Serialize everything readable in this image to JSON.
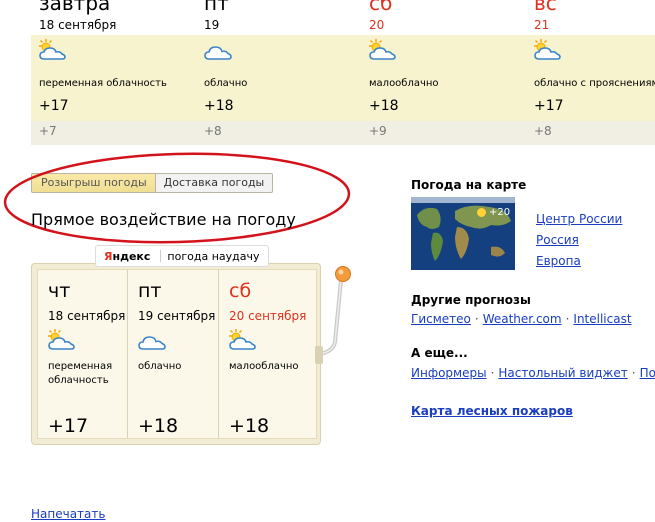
{
  "forecast": {
    "days": [
      {
        "day": "завтра",
        "date": "18 сентября",
        "desc": "переменная облачность",
        "day_temp": "+17",
        "night_temp": "+7",
        "icon": "sun-cloud-icon",
        "weekend": false
      },
      {
        "day": "пт",
        "date": "19",
        "desc": "облачно",
        "day_temp": "+18",
        "night_temp": "+8",
        "icon": "cloud-icon",
        "weekend": false
      },
      {
        "day": "сб",
        "date": "20",
        "desc": "малооблачно",
        "day_temp": "+18",
        "night_temp": "+9",
        "icon": "sun-cloud-icon",
        "weekend": true
      },
      {
        "day": "вс",
        "date": "21",
        "desc": "облачно с прояснениями",
        "day_temp": "+17",
        "night_temp": "+8",
        "icon": "sun-cloud-icon",
        "weekend": true
      }
    ]
  },
  "tabs": [
    "Розыгрыш погоды",
    "Доставка погоды"
  ],
  "promo": {
    "title": "Прямое воздействие на погоду"
  },
  "widget": {
    "badge_logo_a": "Я",
    "badge_logo_b": "ндекс",
    "badge_text": "погода наудачу",
    "days": [
      {
        "day": "чт",
        "date": "18 сентября",
        "desc": "переменная облачность",
        "temp": "+17",
        "weekend": false
      },
      {
        "day": "пт",
        "date": "19 сентября",
        "desc": "облачно",
        "temp": "+18",
        "weekend": false
      },
      {
        "day": "сб",
        "date": "20 сентября",
        "desc": "малооблачно",
        "temp": "+18",
        "weekend": true
      }
    ]
  },
  "map_section": {
    "title": "Погода на карте",
    "map_temp": "+20",
    "links": [
      "Центр России",
      "Россия",
      "Европа"
    ]
  },
  "other": {
    "title": "Другие прогнозы",
    "links": [
      "Гисметео",
      "Weather.com",
      "Intellicast"
    ]
  },
  "more": {
    "title": "А еще...",
    "links": [
      "Информеры",
      "Настольный виджет",
      "Погода"
    ]
  },
  "fires_link": "Карта лесных пожаров",
  "print_link": "Напечатать",
  "colors": {
    "weekend": "#e0301e",
    "link": "#1a3dc1",
    "strip": "#f7f3cf"
  }
}
